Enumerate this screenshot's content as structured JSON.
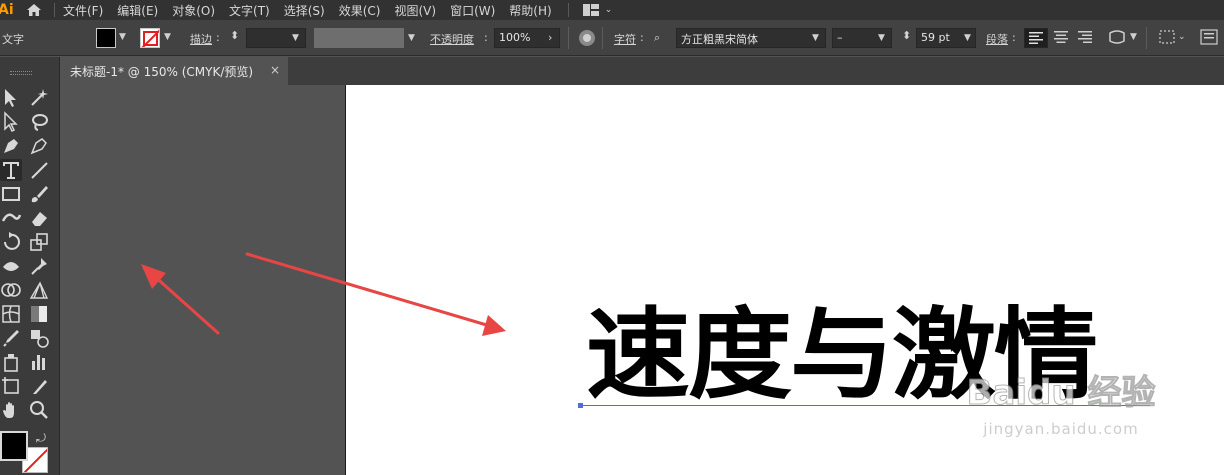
{
  "app": {
    "logo": "Ai",
    "accent": "#ff9a00"
  },
  "menu": [
    "文件(F)",
    "编辑(E)",
    "对象(O)",
    "文字(T)",
    "选择(S)",
    "效果(C)",
    "视图(V)",
    "窗口(W)",
    "帮助(H)"
  ],
  "control": {
    "context": "文字",
    "stroke_label": "描边",
    "opacity_label": "不透明度",
    "opacity_value": "100%",
    "char_label": "字符",
    "font_family": "方正粗黑宋简体",
    "font_style": "–",
    "font_size": "59 pt",
    "para_label": "段落"
  },
  "tab": {
    "title": "未标题-1* @ 150% (CMYK/预览)",
    "close": "×"
  },
  "artboard": {
    "headline": "速度与激情"
  },
  "watermark": {
    "main": "Baidu 经验",
    "sub": "jingyan.baidu.com"
  },
  "colors": {
    "fill": "#000000",
    "annotation": "#e84545",
    "selection": "#4f6fd8"
  }
}
